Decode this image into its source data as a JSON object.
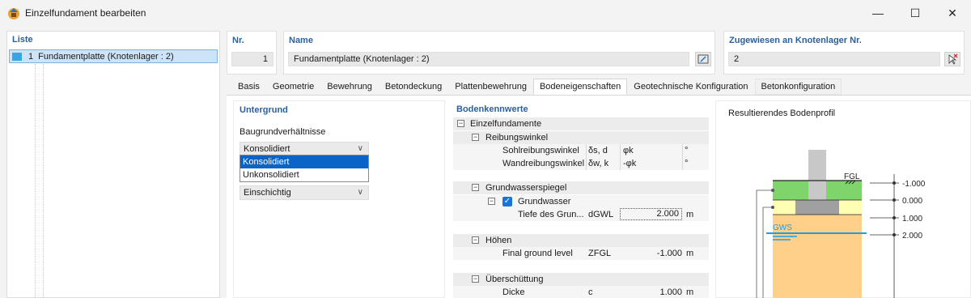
{
  "window": {
    "title": "Einzelfundament bearbeiten",
    "minimize_label": "—",
    "maximize_label": "☐",
    "close_label": "✕"
  },
  "list": {
    "header": "Liste",
    "items": [
      {
        "number": "1",
        "label": "Fundamentplatte (Knotenlager : 2)",
        "color": "#38a7e0"
      }
    ]
  },
  "header": {
    "nr_label": "Nr.",
    "nr_value": "1",
    "name_label": "Name",
    "name_value": "Fundamentplatte (Knotenlager : 2)",
    "assigned_label": "Zugewiesen an Knotenlager Nr.",
    "assigned_value": "2"
  },
  "tabs": [
    {
      "label": "Basis"
    },
    {
      "label": "Geometrie"
    },
    {
      "label": "Bewehrung"
    },
    {
      "label": "Betondeckung"
    },
    {
      "label": "Plattenbewehrung"
    },
    {
      "label": "Bodeneigenschaften",
      "active": true
    },
    {
      "label": "Geotechnische Konfiguration"
    },
    {
      "label": "Betonkonfiguration"
    }
  ],
  "untergrund": {
    "header": "Untergrund",
    "label": "Baugrundverhältnisse",
    "selected": "Konsolidiert",
    "options": [
      "Konsolidiert",
      "Unkonsolidiert"
    ],
    "second_select": "Einschichtig"
  },
  "kennwerte": {
    "header": "Bodenkennwerte",
    "root": "Einzelfundamente",
    "groups": {
      "reibung": {
        "label": "Reibungswinkel",
        "rows": [
          {
            "name": "Sohlreibungswinkel",
            "symbol": "δs, d",
            "value": "φk",
            "unit": "°"
          },
          {
            "name": "Wandreibungswinkel",
            "symbol": "δw, k",
            "value": "-φk",
            "unit": "°"
          }
        ]
      },
      "grundwasser": {
        "label": "Grundwasserspiegel",
        "checkbox_label": "Grundwasser",
        "checked": true,
        "row": {
          "name": "Tiefe des Grun...",
          "symbol": "dGWL",
          "value": "2.000",
          "unit": "m"
        }
      },
      "hoehen": {
        "label": "Höhen",
        "row": {
          "name": "Final ground level",
          "symbol": "ZFGL",
          "value": "-1.000",
          "unit": "m"
        }
      },
      "ueberschuettung": {
        "label": "Überschüttung",
        "row": {
          "name": "Dicke",
          "symbol": "c",
          "value": "1.000",
          "unit": "m"
        }
      }
    }
  },
  "profil": {
    "title": "Resultierendes Bodenprofil",
    "fgl_label": "FGL",
    "gws_label": "GWS",
    "levels": [
      "-1.000",
      "0.000",
      "1.000",
      "2.000"
    ],
    "colors": {
      "fill": "#7fd46b",
      "upper_soil": "#ffffb3",
      "lower_soil": "#ffd08a",
      "footing": "#a0a0a0",
      "groundwater": "#1e9ee0"
    }
  }
}
